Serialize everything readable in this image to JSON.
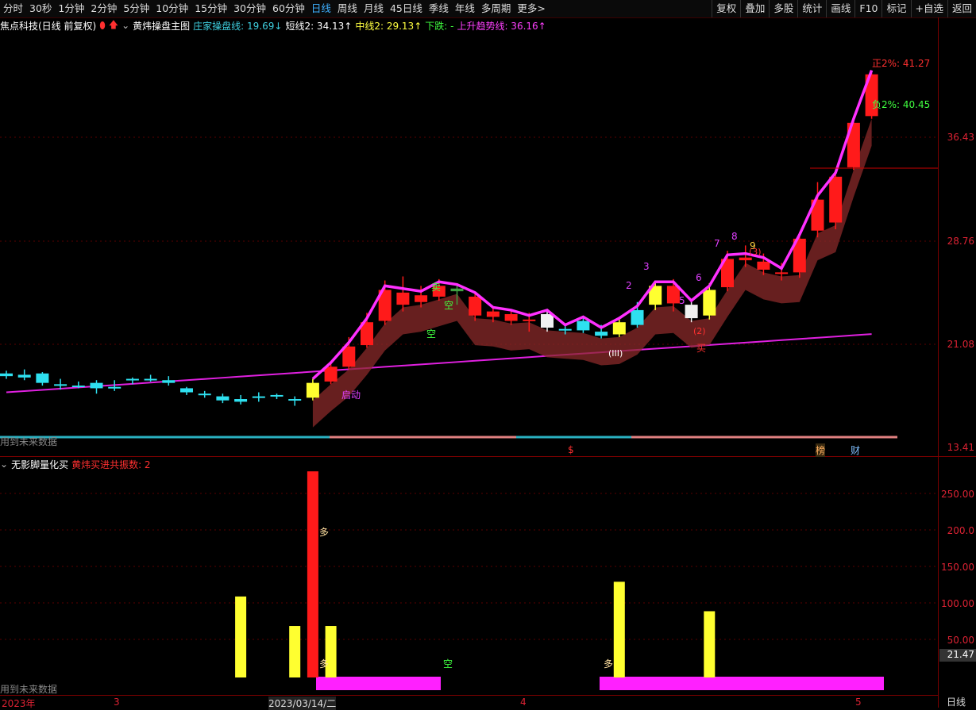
{
  "toolbar": {
    "periods": [
      "分时",
      "30秒",
      "1分钟",
      "2分钟",
      "5分钟",
      "10分钟",
      "15分钟",
      "30分钟",
      "60分钟",
      "日线",
      "周线",
      "月线",
      "45日线",
      "季线",
      "年线",
      "多周期",
      "更多>"
    ],
    "active_period": "日线",
    "right_buttons": [
      "复权",
      "叠加",
      "多股",
      "统计",
      "画线",
      "F10",
      "标记",
      "+自选",
      "返回"
    ]
  },
  "main": {
    "stock_title": "焦点科技(日线 前复权)",
    "indicator_name": "黄炜操盘主图",
    "legend": [
      {
        "text": "庄家操盘线: 19.69↓",
        "color": "#3fd0e0"
      },
      {
        "text": "短线2: 34.13↑",
        "color": "#ffffff"
      },
      {
        "text": "中线2: 29.13↑",
        "color": "#ffff40"
      },
      {
        "text": "下跌: -",
        "color": "#40ff40"
      },
      {
        "text": "上升趋势线: 36.16↑",
        "color": "#ff40ff"
      }
    ],
    "price_labels": [
      "36.43",
      "28.76",
      "21.08",
      "13.41"
    ],
    "upper_band_label": "正2%: 41.27",
    "lower_band_label": "负2%: 40.45",
    "future_text": "用到未来数据",
    "signals": [
      "卖",
      "空",
      "空",
      "买",
      "2",
      "3",
      "5",
      "6",
      "7",
      "8",
      "9",
      "(3)",
      "(2)",
      "(III)",
      "启动"
    ],
    "markers": [
      "$",
      "榜",
      "财"
    ]
  },
  "sub": {
    "name": "无影脚量化买",
    "legend": "黄炜买进共振数: 2",
    "axis_labels": [
      "250.00",
      "200.0",
      "150.00",
      "100.00",
      "50.00"
    ],
    "current_value": "21.47",
    "future_text": "用到未来数据",
    "bar_labels": [
      "多",
      "多",
      "空",
      "多"
    ]
  },
  "date_axis": {
    "labels": [
      "2023年",
      "3",
      "2023/03/14/二",
      "4",
      "5"
    ],
    "period_label": "日线"
  },
  "chart_data": [
    {
      "type": "candlestick",
      "title": "黄炜操盘主图",
      "ylim": [
        13.41,
        41.27
      ],
      "y_ticks": [
        36.43,
        28.76,
        21.08,
        13.41
      ],
      "candles": [
        {
          "o": 18.9,
          "c": 18.7,
          "h": 19.1,
          "l": 18.5,
          "color": "cyan"
        },
        {
          "o": 18.6,
          "c": 18.8,
          "h": 19.2,
          "l": 18.4,
          "color": "cyan"
        },
        {
          "o": 18.9,
          "c": 18.2,
          "h": 19.0,
          "l": 18.0,
          "color": "cyan"
        },
        {
          "o": 18.1,
          "c": 18.0,
          "h": 18.5,
          "l": 17.7,
          "color": "cyan"
        },
        {
          "o": 18.0,
          "c": 18.0,
          "h": 18.3,
          "l": 17.8,
          "color": "cyan"
        },
        {
          "o": 18.2,
          "c": 17.8,
          "h": 18.4,
          "l": 17.4,
          "color": "cyan"
        },
        {
          "o": 17.9,
          "c": 17.9,
          "h": 18.4,
          "l": 17.6,
          "color": "cyan"
        },
        {
          "o": 18.5,
          "c": 18.5,
          "h": 18.6,
          "l": 18.1,
          "color": "cyan"
        },
        {
          "o": 18.5,
          "c": 18.5,
          "h": 18.8,
          "l": 18.3,
          "color": "cyan"
        },
        {
          "o": 18.4,
          "c": 18.2,
          "h": 18.7,
          "l": 18.0,
          "color": "cyan"
        },
        {
          "o": 17.8,
          "c": 17.5,
          "h": 17.9,
          "l": 17.3,
          "color": "cyan"
        },
        {
          "o": 17.4,
          "c": 17.3,
          "h": 17.6,
          "l": 17.1,
          "color": "cyan"
        },
        {
          "o": 17.2,
          "c": 16.9,
          "h": 17.4,
          "l": 16.7,
          "color": "cyan"
        },
        {
          "o": 17.0,
          "c": 16.8,
          "h": 17.3,
          "l": 16.6,
          "color": "cyan"
        },
        {
          "o": 17.1,
          "c": 17.2,
          "h": 17.5,
          "l": 16.8,
          "color": "cyan"
        },
        {
          "o": 17.2,
          "c": 17.3,
          "h": 17.4,
          "l": 17.0,
          "color": "cyan"
        },
        {
          "o": 17.0,
          "c": 16.9,
          "h": 17.2,
          "l": 16.5,
          "color": "cyan"
        },
        {
          "o": 17.1,
          "c": 18.2,
          "h": 18.5,
          "l": 16.9,
          "color": "yellow"
        },
        {
          "o": 18.3,
          "c": 19.4,
          "h": 19.8,
          "l": 18.1,
          "color": "red"
        },
        {
          "o": 19.4,
          "c": 20.9,
          "h": 21.6,
          "l": 19.2,
          "color": "red"
        },
        {
          "o": 21.0,
          "c": 22.7,
          "h": 23.4,
          "l": 20.8,
          "color": "red"
        },
        {
          "o": 22.8,
          "c": 25.1,
          "h": 25.8,
          "l": 22.5,
          "color": "red"
        },
        {
          "o": 24.9,
          "c": 24.0,
          "h": 26.1,
          "l": 23.5,
          "color": "red"
        },
        {
          "o": 24.2,
          "c": 24.7,
          "h": 25.4,
          "l": 23.8,
          "color": "red"
        },
        {
          "o": 24.6,
          "c": 25.4,
          "h": 25.9,
          "l": 24.3,
          "color": "red"
        },
        {
          "o": 25.2,
          "c": 25.0,
          "h": 25.6,
          "l": 24.0,
          "color": "green"
        },
        {
          "o": 24.6,
          "c": 23.2,
          "h": 24.9,
          "l": 22.8,
          "color": "red"
        },
        {
          "o": 23.1,
          "c": 23.5,
          "h": 23.8,
          "l": 22.7,
          "color": "red"
        },
        {
          "o": 23.3,
          "c": 22.8,
          "h": 23.6,
          "l": 22.5,
          "color": "red"
        },
        {
          "o": 22.9,
          "c": 22.9,
          "h": 23.4,
          "l": 22.0,
          "color": "red"
        },
        {
          "o": 23.3,
          "c": 22.3,
          "h": 23.5,
          "l": 22.0,
          "color": "white"
        },
        {
          "o": 22.2,
          "c": 22.2,
          "h": 22.6,
          "l": 21.8,
          "color": "cyan"
        },
        {
          "o": 22.8,
          "c": 22.1,
          "h": 23.1,
          "l": 21.9,
          "color": "cyan"
        },
        {
          "o": 22.0,
          "c": 21.7,
          "h": 22.5,
          "l": 21.5,
          "color": "cyan"
        },
        {
          "o": 21.8,
          "c": 22.7,
          "h": 23.1,
          "l": 21.6,
          "color": "yellow"
        },
        {
          "o": 22.5,
          "c": 23.6,
          "h": 24.2,
          "l": 22.3,
          "color": "cyan"
        },
        {
          "o": 24.0,
          "c": 25.4,
          "h": 25.8,
          "l": 23.6,
          "color": "yellow"
        },
        {
          "o": 25.4,
          "c": 24.1,
          "h": 25.9,
          "l": 23.5,
          "color": "red"
        },
        {
          "o": 24.0,
          "c": 23.0,
          "h": 24.3,
          "l": 22.7,
          "color": "white"
        },
        {
          "o": 23.2,
          "c": 25.1,
          "h": 25.6,
          "l": 22.9,
          "color": "yellow"
        },
        {
          "o": 25.3,
          "c": 27.4,
          "h": 28.0,
          "l": 25.0,
          "color": "red"
        },
        {
          "o": 27.3,
          "c": 27.5,
          "h": 28.4,
          "l": 26.8,
          "color": "red"
        },
        {
          "o": 27.2,
          "c": 26.6,
          "h": 27.8,
          "l": 26.2,
          "color": "red"
        },
        {
          "o": 26.3,
          "c": 26.4,
          "h": 27.1,
          "l": 25.8,
          "color": "red"
        },
        {
          "o": 26.4,
          "c": 28.9,
          "h": 29.4,
          "l": 26.0,
          "color": "red"
        },
        {
          "o": 29.5,
          "c": 31.8,
          "h": 33.1,
          "l": 29.0,
          "color": "red"
        },
        {
          "o": 33.5,
          "c": 30.1,
          "h": 34.0,
          "l": 29.6,
          "color": "red"
        },
        {
          "o": 34.2,
          "c": 37.5,
          "h": 38.0,
          "l": 34.0,
          "color": "red"
        },
        {
          "o": 38.0,
          "c": 41.1,
          "h": 41.2,
          "l": 37.8,
          "color": "red"
        }
      ]
    },
    {
      "type": "bar",
      "title": "无影脚量化买",
      "ylim": [
        0,
        300
      ],
      "bars": [
        {
          "i": 13,
          "value": 110,
          "color": "yellow"
        },
        {
          "i": 16,
          "value": 70,
          "color": "yellow"
        },
        {
          "i": 17,
          "value": 280,
          "color": "red"
        },
        {
          "i": 18,
          "value": 70,
          "color": "yellow"
        },
        {
          "i": 34,
          "value": 130,
          "color": "yellow"
        },
        {
          "i": 39,
          "value": 90,
          "color": "yellow"
        }
      ]
    }
  ]
}
